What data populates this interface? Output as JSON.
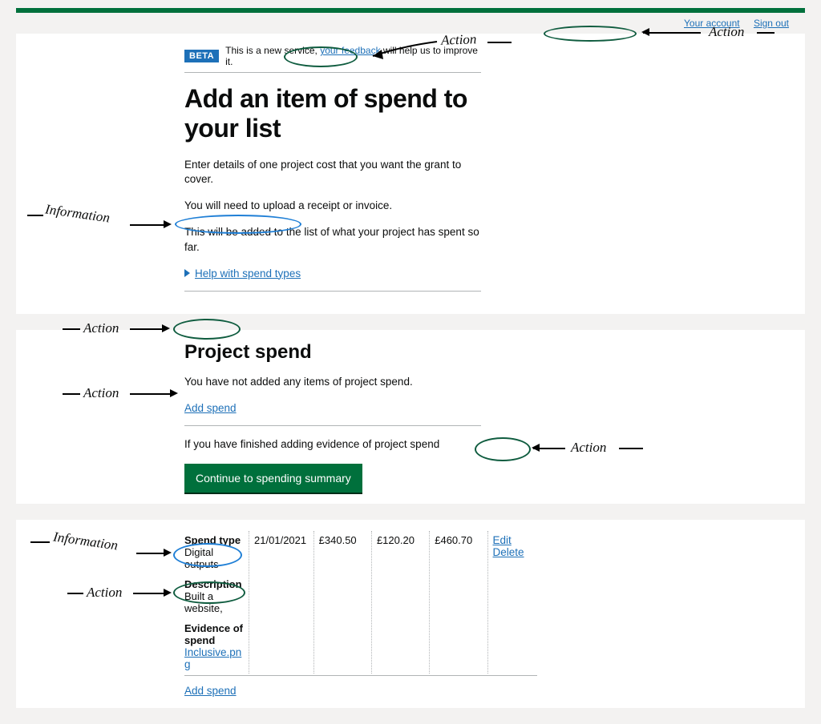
{
  "header": {
    "account_link": "Your account",
    "signout_link": "Sign out"
  },
  "beta": {
    "badge": "BETA",
    "pre": "This is a new service,",
    "link": "your feedback",
    "post": "will help us to improve it."
  },
  "main": {
    "h1": "Add an item of spend to your list",
    "p1": "Enter details of one project cost that you want the grant to cover.",
    "p2": "You will need to upload a receipt or invoice.",
    "p3": "This will be added to the list of what your project has spent so far.",
    "details": "Help with spend types"
  },
  "ps": {
    "h2": "Project spend",
    "empty": "You have not added any items of project spend.",
    "add": "Add spend",
    "finished": "If you have finished adding evidence of project spend",
    "continue": "Continue to spending summary"
  },
  "row": {
    "spendtype_h": "Spend type",
    "spendtype_v": "Digital outputs",
    "desc_h": "Description",
    "desc_v": "Built a website,",
    "ev_h": "Evidence of spend",
    "ev_file": "Inclusive.png",
    "date": "21/01/2021",
    "net": "£340.50",
    "vat": "£120.20",
    "gross": "£460.70",
    "edit": "Edit",
    "delete": "Delete",
    "add2": "Add spend"
  },
  "ann": {
    "action": "Action",
    "info": "Information"
  }
}
